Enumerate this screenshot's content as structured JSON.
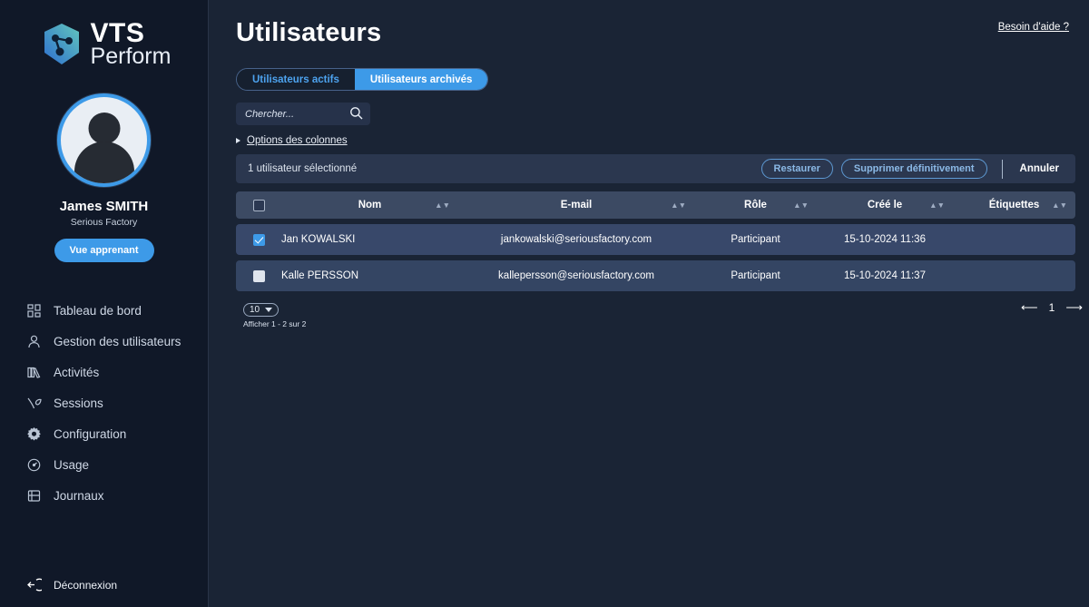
{
  "brand": {
    "line1": "VTS",
    "line2": "Perform",
    "logo_icon": "vts-hexagon-nodes-logo"
  },
  "profile": {
    "name": "James SMITH",
    "organization": "Serious Factory",
    "learner_button": "Vue apprenant",
    "avatar_icon": "user-avatar"
  },
  "sidebar": {
    "items": [
      {
        "label": "Tableau de bord",
        "icon": "dashboard-grid-icon"
      },
      {
        "label": "Gestion des utilisateurs",
        "icon": "user-icon"
      },
      {
        "label": "Activités",
        "icon": "books-icon"
      },
      {
        "label": "Sessions",
        "icon": "sessions-icon"
      },
      {
        "label": "Configuration",
        "icon": "gear-icon"
      },
      {
        "label": "Usage",
        "icon": "gauge-icon"
      },
      {
        "label": "Journaux",
        "icon": "logs-icon"
      }
    ],
    "logout": {
      "label": "Déconnexion",
      "icon": "logout-icon"
    }
  },
  "header": {
    "title": "Utilisateurs",
    "help_link": "Besoin d'aide ?"
  },
  "tabs": [
    {
      "label": "Utilisateurs actifs",
      "active": false
    },
    {
      "label": "Utilisateurs archivés",
      "active": true
    }
  ],
  "search": {
    "placeholder": "Chercher...",
    "value": "",
    "icon": "search-icon"
  },
  "column_options": {
    "label": "Options des colonnes",
    "expanded": false
  },
  "selection_bar": {
    "count_text": "1 utilisateur sélectionné",
    "restore_label": "Restaurer",
    "delete_label": "Supprimer définitivement",
    "cancel_label": "Annuler"
  },
  "table": {
    "columns": [
      {
        "label": "Nom",
        "sortable": true
      },
      {
        "label": "E-mail",
        "sortable": true
      },
      {
        "label": "Rôle",
        "sortable": true
      },
      {
        "label": "Créé le",
        "sortable": true
      },
      {
        "label": "Étiquettes",
        "sortable": true
      }
    ],
    "rows": [
      {
        "selected": true,
        "name": "Jan KOWALSKI",
        "email": "jankowalski@seriousfactory.com",
        "role": "Participant",
        "created": "15-10-2024 11:36",
        "tags": ""
      },
      {
        "selected": false,
        "name": "Kalle PERSSON",
        "email": "kallepersson@seriousfactory.com",
        "role": "Participant",
        "created": "15-10-2024 11:37",
        "tags": ""
      }
    ]
  },
  "footer": {
    "page_size": "10",
    "showing": "Afficher 1 - 2 sur 2",
    "page_number": "1",
    "prev_icon": "arrow-left-icon",
    "next_icon": "arrow-right-icon"
  },
  "colors": {
    "accent": "#3d9ae8",
    "sidebar_bg": "#101828",
    "main_bg": "#1a2435",
    "row_bg": "#344563",
    "header_row_bg": "#3c4a63"
  }
}
